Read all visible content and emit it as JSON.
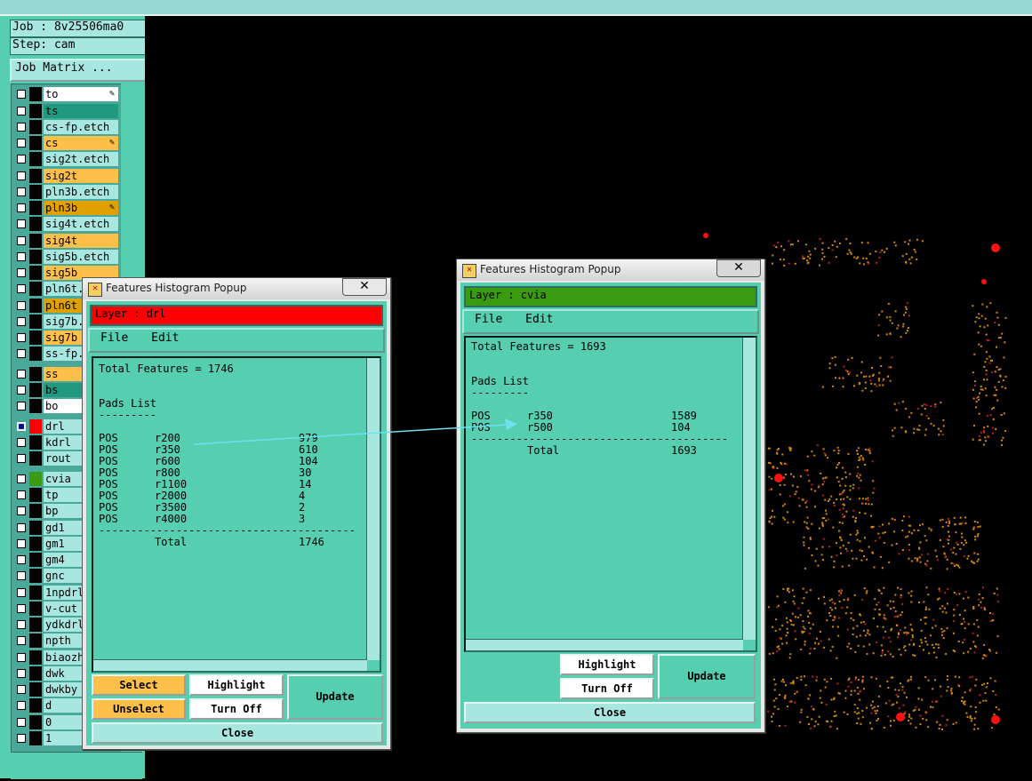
{
  "job_label": "Job : 8v25506ma0",
  "step_label": "Step: cam",
  "job_matrix_label": "Job Matrix ...",
  "layers": [
    {
      "name": "to",
      "bg": "#ffffff",
      "swatch": "#000000",
      "flag": "✎"
    },
    {
      "name": "ts",
      "bg": "#1f9a7e",
      "swatch": "#000000",
      "flag": ""
    },
    {
      "name": "cs-fp.etch",
      "bg": "#a8e6e0",
      "swatch": "#000000",
      "flag": ""
    },
    {
      "name": "cs",
      "bg": "#ffc04a",
      "swatch": "#000000",
      "flag": "✎"
    },
    {
      "name": "sig2t.etch",
      "bg": "#a8e6e0",
      "swatch": "#000000",
      "flag": ""
    },
    {
      "name": "sig2t",
      "bg": "#ffc04a",
      "swatch": "#000000",
      "flag": ""
    },
    {
      "name": "pln3b.etch",
      "bg": "#a8e6e0",
      "swatch": "#000000",
      "flag": ""
    },
    {
      "name": "pln3b",
      "bg": "#e0a000",
      "swatch": "#000000",
      "flag": "✎"
    },
    {
      "name": "sig4t.etch",
      "bg": "#a8e6e0",
      "swatch": "#000000",
      "flag": ""
    },
    {
      "name": "sig4t",
      "bg": "#ffc04a",
      "swatch": "#000000",
      "flag": ""
    },
    {
      "name": "sig5b.etch",
      "bg": "#a8e6e0",
      "swatch": "#000000",
      "flag": ""
    },
    {
      "name": "sig5b",
      "bg": "#ffc04a",
      "swatch": "#000000",
      "flag": ""
    },
    {
      "name": "pln6t.etch",
      "bg": "#a8e6e0",
      "swatch": "#000000",
      "flag": ""
    },
    {
      "name": "pln6t",
      "bg": "#e0a000",
      "swatch": "#000000",
      "flag": ""
    },
    {
      "name": "sig7b.etch",
      "bg": "#a8e6e0",
      "swatch": "#000000",
      "flag": ""
    },
    {
      "name": "sig7b",
      "bg": "#ffc04a",
      "swatch": "#000000",
      "flag": ""
    },
    {
      "name": "ss-fp.etch",
      "bg": "#a8e6e0",
      "swatch": "#000000",
      "flag": ""
    },
    {
      "name": "ss",
      "bg": "#ffc04a",
      "swatch": "#000000",
      "flag": ""
    },
    {
      "name": "bs",
      "bg": "#1f9a7e",
      "swatch": "#000000",
      "flag": ""
    },
    {
      "name": "bo",
      "bg": "#ffffff",
      "swatch": "#000000",
      "flag": ""
    },
    {
      "name": "drl",
      "bg": "#a8e6e0",
      "swatch": "#ff0000",
      "flag": ""
    },
    {
      "name": "kdrl",
      "bg": "#a8e6e0",
      "swatch": "#000000",
      "flag": ""
    },
    {
      "name": "rout",
      "bg": "#a8e6e0",
      "swatch": "#000000",
      "flag": ""
    },
    {
      "name": "cvia",
      "bg": "#a8e6e0",
      "swatch": "#3a9a10",
      "flag": ""
    },
    {
      "name": "tp",
      "bg": "#a8e6e0",
      "swatch": "#000000",
      "flag": ""
    },
    {
      "name": "bp",
      "bg": "#a8e6e0",
      "swatch": "#000000",
      "flag": ""
    },
    {
      "name": "gd1",
      "bg": "#a8e6e0",
      "swatch": "#000000",
      "flag": ""
    },
    {
      "name": "gm1",
      "bg": "#a8e6e0",
      "swatch": "#000000",
      "flag": ""
    },
    {
      "name": "gm4",
      "bg": "#a8e6e0",
      "swatch": "#000000",
      "flag": ""
    },
    {
      "name": "gnc",
      "bg": "#a8e6e0",
      "swatch": "#000000",
      "flag": ""
    },
    {
      "name": "1npdrl",
      "bg": "#a8e6e0",
      "swatch": "#000000",
      "flag": ""
    },
    {
      "name": "v-cut",
      "bg": "#a8e6e0",
      "swatch": "#000000",
      "flag": ""
    },
    {
      "name": "ydkdrl",
      "bg": "#a8e6e0",
      "swatch": "#000000",
      "flag": ""
    },
    {
      "name": "npth",
      "bg": "#a8e6e0",
      "swatch": "#000000",
      "flag": ""
    },
    {
      "name": "biaozh",
      "bg": "#a8e6e0",
      "swatch": "#000000",
      "flag": ""
    },
    {
      "name": "dwk",
      "bg": "#a8e6e0",
      "swatch": "#000000",
      "flag": ""
    },
    {
      "name": "dwkby",
      "bg": "#a8e6e0",
      "swatch": "#000000",
      "flag": ""
    },
    {
      "name": "d",
      "bg": "#a8e6e0",
      "swatch": "#000000",
      "flag": ""
    },
    {
      "name": "0",
      "bg": "#a8e6e0",
      "swatch": "#000000",
      "flag": ""
    },
    {
      "name": "1",
      "bg": "#a8e6e0",
      "swatch": "#000000",
      "flag": ""
    }
  ],
  "popup1": {
    "title": "Features Histogram Popup",
    "close_glyph": "✕",
    "layer_label": "Layer :  drl",
    "layer_color": "#ff0000",
    "menu": {
      "file": "File",
      "edit": "Edit"
    },
    "total_line": "Total Features = 1746",
    "pads_header": "Pads List",
    "pads_rule": "---------",
    "rows": [
      {
        "pol": "POS",
        "sym": "r200",
        "count": "979"
      },
      {
        "pol": "POS",
        "sym": "r350",
        "count": "610"
      },
      {
        "pol": "POS",
        "sym": "r600",
        "count": "104"
      },
      {
        "pol": "POS",
        "sym": "r800",
        "count": "30"
      },
      {
        "pol": "POS",
        "sym": "r1100",
        "count": "14"
      },
      {
        "pol": "POS",
        "sym": "r2000",
        "count": "4"
      },
      {
        "pol": "POS",
        "sym": "r3500",
        "count": "2"
      },
      {
        "pol": "POS",
        "sym": "r4000",
        "count": "3"
      }
    ],
    "rule": "------------------------------------------",
    "total_label": "Total",
    "total_value": "1746",
    "buttons": {
      "select": "Select",
      "unselect": "Unselect",
      "highlight": "Highlight",
      "turn_off": "Turn Off",
      "update": "Update",
      "close": "Close"
    }
  },
  "popup2": {
    "title": "Features Histogram Popup",
    "close_glyph": "✕",
    "layer_label": "Layer :  cvia",
    "layer_color": "#3a9a10",
    "menu": {
      "file": "File",
      "edit": "Edit"
    },
    "total_line": "Total Features = 1693",
    "pads_header": "Pads List",
    "pads_rule": "---------",
    "rows": [
      {
        "pol": "POS",
        "sym": "r350",
        "count": "1589"
      },
      {
        "pol": "POS",
        "sym": "r500",
        "count": "104"
      }
    ],
    "rule": "------------------------------------------",
    "total_label": "Total",
    "total_value": "1693",
    "buttons": {
      "highlight": "Highlight",
      "turn_off": "Turn Off",
      "update": "Update",
      "close": "Close"
    }
  }
}
